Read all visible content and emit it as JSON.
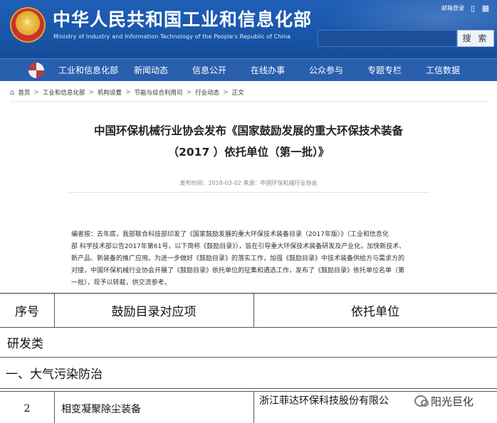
{
  "header": {
    "site_title": "中华人民共和国工业和信息化部",
    "site_subtitle": "Ministry of Industry and Information Technology of the People's Republic of China",
    "login_label": "邮箱登录",
    "search_button": "搜 索",
    "search_placeholder": ""
  },
  "nav": {
    "items": [
      {
        "label": "工业和信息化部"
      },
      {
        "label": "新闻动态"
      },
      {
        "label": "信息公开"
      },
      {
        "label": "在线办事"
      },
      {
        "label": "公众参与"
      },
      {
        "label": "专题专栏"
      },
      {
        "label": "工信数据"
      }
    ]
  },
  "breadcrumb": {
    "items": [
      "首页",
      "工业和信息化部",
      "机构设置",
      "节能与综合利用司",
      "行业动态",
      "正文"
    ],
    "separator": ">"
  },
  "article": {
    "title_line1": "中国环保机械行业协会发布《国家鼓励发展的重大环保技术装备",
    "title_line2": "（2017 ）依托单位（第一批）》",
    "meta": "发布时间：2018-03-02  来源：中国环保机械行业协会",
    "intro_lines": [
      "编者按：去年底，我部联合科技部印发了《国家鼓励发展的重大环保技术装备目录（2017年版）》（工业和信息化",
      "部 科学技术部公告2017年第61号，以下简称《鼓励目录》），旨在引导重大环保技术装备研发及产业化，加快新技术、",
      "新产品、新装备的推广应用。为进一步做好《鼓励目录》的落实工作，加强《鼓励目录》中技术装备供给方与需求方的",
      "对接，中国环保机械行业协会开展了《鼓励目录》依托单位的征集和遴选工作，发布了《鼓励目录》依托单位名单（第",
      "一批），现予以转载，供交流参考。"
    ]
  },
  "table": {
    "headers": [
      "序号",
      "鼓励目录对应项",
      "依托单位"
    ],
    "section_category": "研发类",
    "section_sub": "一、大气污染防治",
    "rows": [
      {
        "no": "2",
        "item": "相变凝聚除尘装备",
        "unit": "浙江菲达环保科技股份有限公"
      }
    ]
  },
  "watermark": {
    "text": "阳光巨化"
  },
  "icons": {
    "home": "home-icon",
    "mobile": "mobile-icon",
    "grid": "grid-icon",
    "emblem": "national-emblem-icon"
  }
}
